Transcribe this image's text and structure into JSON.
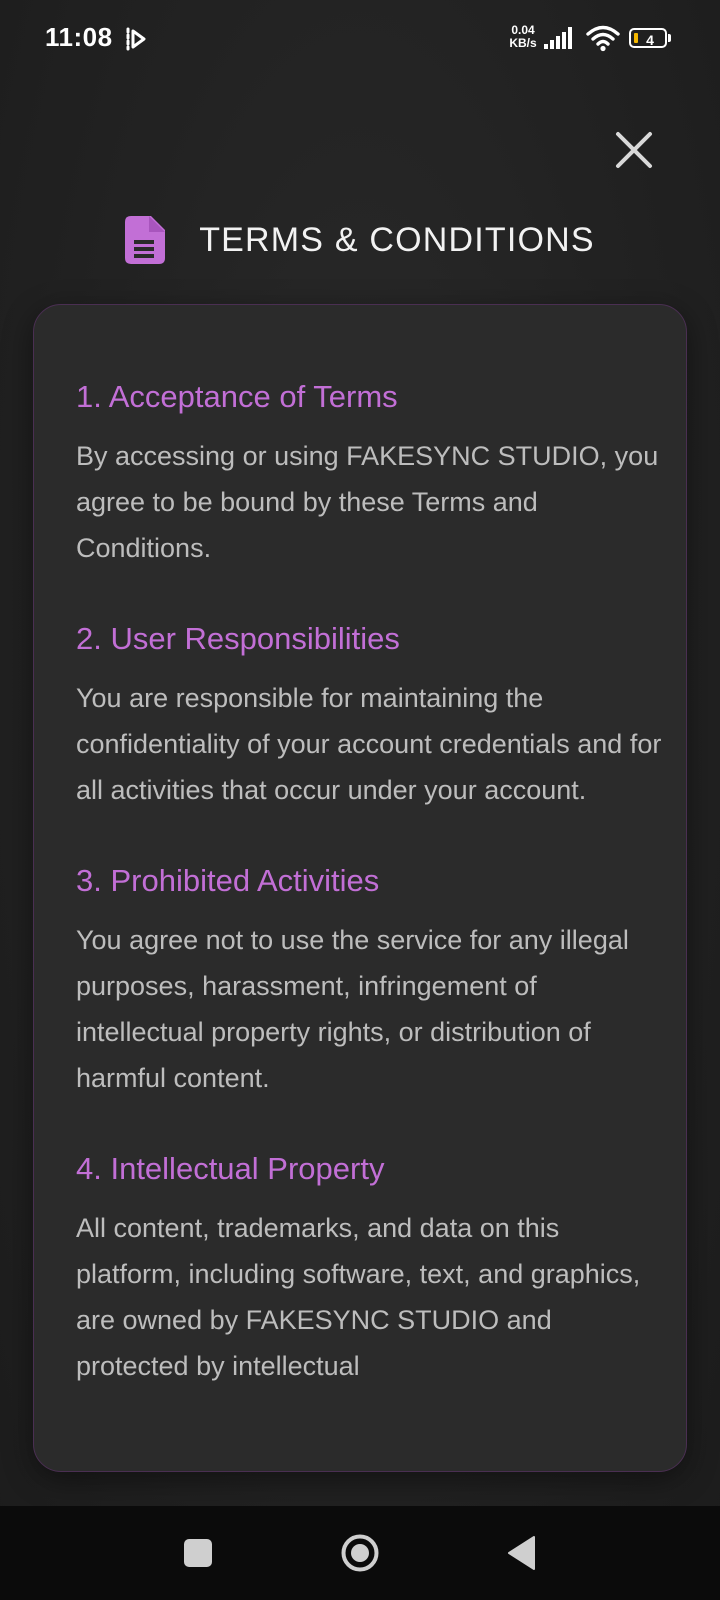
{
  "status_bar": {
    "time": "11:08",
    "net_speed_value": "0.04",
    "net_speed_unit": "KB/s",
    "battery_level": "4",
    "icons": [
      "app-notification-icon",
      "signal-icon",
      "wifi-icon",
      "battery-icon"
    ]
  },
  "header": {
    "icon": "document-icon",
    "title": "TERMS & CONDITIONS",
    "close_icon": "close-icon"
  },
  "sections": [
    {
      "title": "1. Acceptance of Terms",
      "body": "By accessing or using FAKESYNC STUDIO, you agree to be bound by these Terms and Conditions."
    },
    {
      "title": "2. User Responsibilities",
      "body": "You are responsible for maintaining the confidentiality of your account credentials and for all activities that occur under your account."
    },
    {
      "title": "3. Prohibited Activities",
      "body": "You agree not to use the service for any illegal purposes, harassment, infringement of intellectual property rights, or distribution of harmful content."
    },
    {
      "title": "4. Intellectual Property",
      "body": "All content, trademarks, and data on this platform, including software, text, and graphics, are owned by FAKESYNC STUDIO and protected by intellectual"
    }
  ],
  "nav_bar": {
    "icons": [
      "recent-apps-icon",
      "home-icon",
      "back-icon"
    ]
  },
  "colors": {
    "accent": "#c26fd6",
    "background": "#222222",
    "card": "#2b2b2b",
    "body_text": "#bdbdbd"
  }
}
